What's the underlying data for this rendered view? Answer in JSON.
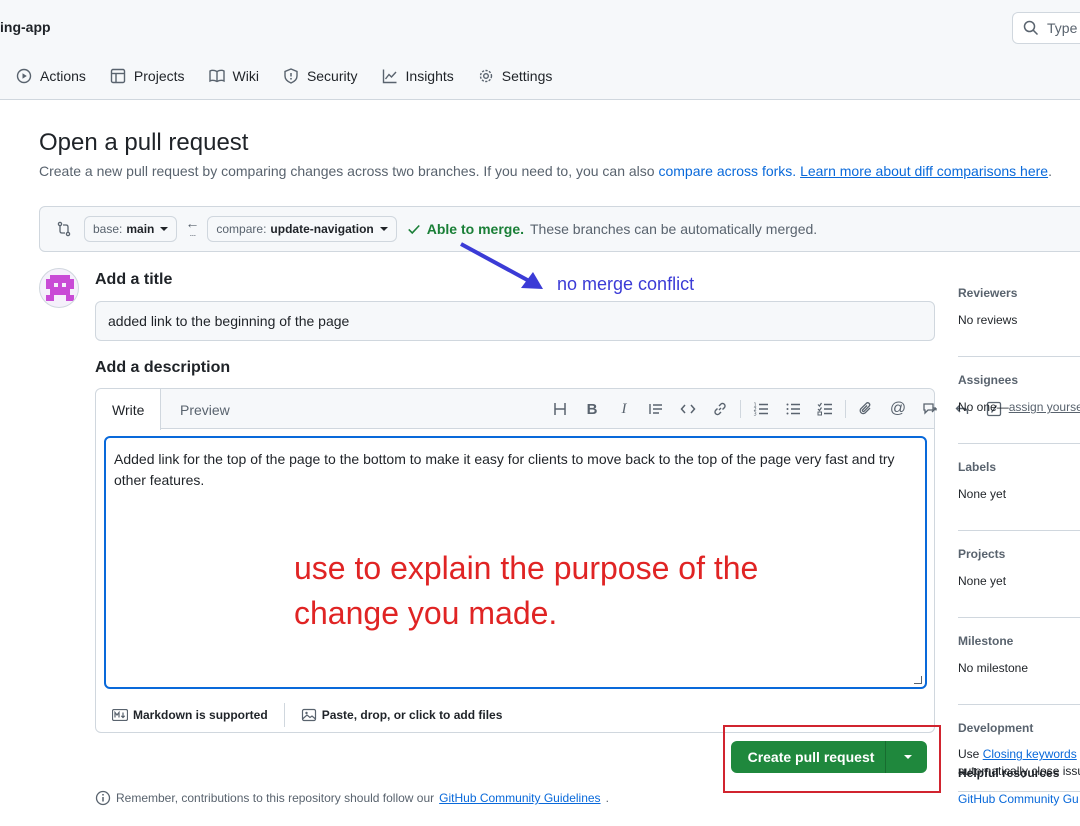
{
  "header": {
    "repo_name": "ing-app",
    "search_placeholder": "Type",
    "nav": [
      {
        "label": "Actions",
        "icon": "play-icon"
      },
      {
        "label": "Projects",
        "icon": "table-icon"
      },
      {
        "label": "Wiki",
        "icon": "book-icon"
      },
      {
        "label": "Security",
        "icon": "shield-icon"
      },
      {
        "label": "Insights",
        "icon": "graph-icon"
      },
      {
        "label": "Settings",
        "icon": "gear-icon"
      }
    ]
  },
  "page": {
    "title": "Open a pull request",
    "description_prefix": "Create a new pull request by comparing changes across two branches. If you need to, you can also",
    "link_compare_forks": "compare across forks.",
    "link_learn_more": "Learn more about diff comparisons here",
    "description_suffix": "."
  },
  "compare": {
    "base_prefix": "base:",
    "base_branch": "main",
    "compare_prefix": "compare:",
    "compare_branch": "update-navigation",
    "status_bold": "Able to merge.",
    "status_text": "These branches can be automatically merged."
  },
  "form": {
    "title_label": "Add a title",
    "title_value": "added link to the beginning of the page",
    "description_label": "Add a description",
    "tab_write": "Write",
    "tab_preview": "Preview",
    "body_text": "Added link for the top of the page to the bottom to make it easy for clients to move back to the top of the page very fast and try other features.",
    "markdown_note": "Markdown is supported",
    "attach_note": "Paste, drop, or click to add files",
    "create_button": "Create pull request",
    "remember_prefix": "Remember, contributions to this repository should follow our",
    "remember_link": "GitHub Community Guidelines",
    "remember_suffix": "."
  },
  "sidebar": {
    "sections": [
      {
        "heading": "Reviewers",
        "value": "No reviews"
      },
      {
        "heading": "Assignees",
        "value": "No one—",
        "link": "assign yourse"
      },
      {
        "heading": "Labels",
        "value": "None yet"
      },
      {
        "heading": "Projects",
        "value": "None yet"
      },
      {
        "heading": "Milestone",
        "value": "No milestone"
      },
      {
        "heading": "Development",
        "value": "Use ",
        "link": "Closing keywords",
        "value2": " i",
        "value3": "automatically close issu"
      }
    ],
    "helpful_heading": "Helpful resources",
    "helpful_link": "GitHub Community Gu"
  },
  "annotations": {
    "blue_note": "no merge conflict",
    "red_note_line1": "use to explain the purpose of the",
    "red_note_line2": "change you made."
  },
  "colors": {
    "accent_blue": "#0969da",
    "merge_green": "#1a7f37",
    "button_green": "#1f883d",
    "annotation_blue": "#3b3bd6",
    "annotation_red": "#e02424"
  }
}
